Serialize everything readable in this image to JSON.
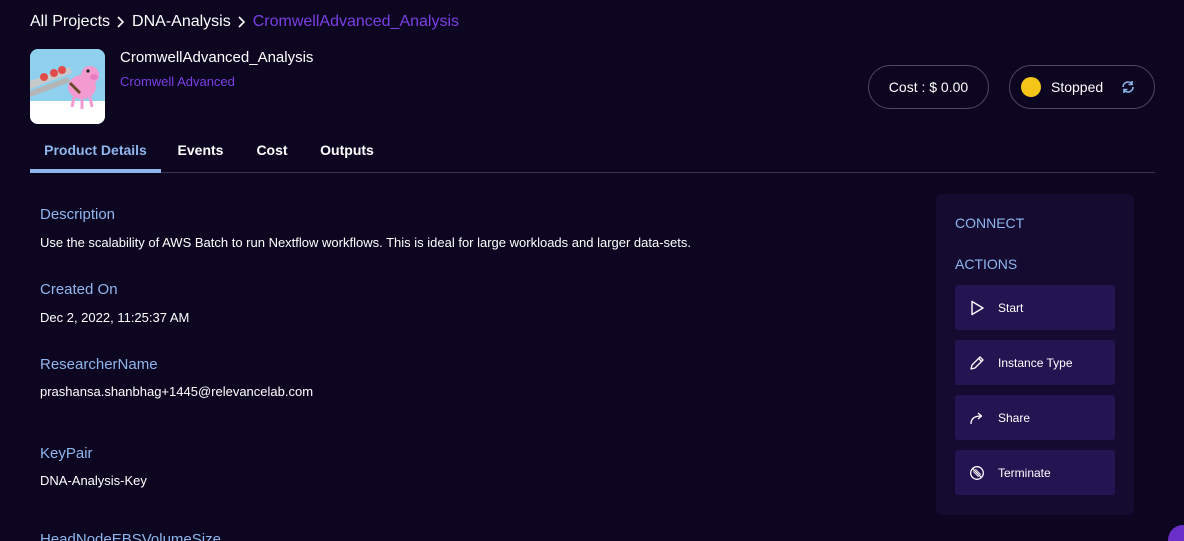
{
  "breadcrumb": {
    "items": [
      "All Projects",
      "DNA-Analysis",
      "CromwellAdvanced_Analysis"
    ]
  },
  "product": {
    "title": "CromwellAdvanced_Analysis",
    "subtitle": "Cromwell Advanced",
    "logo_icon": "flying-pig-logo"
  },
  "cost": {
    "label": "Cost : $ 0.00"
  },
  "status": {
    "label": "Stopped",
    "color": "#f5c518"
  },
  "tabs": [
    {
      "label": "Product Details",
      "active": true
    },
    {
      "label": "Events",
      "active": false
    },
    {
      "label": "Cost",
      "active": false
    },
    {
      "label": "Outputs",
      "active": false
    }
  ],
  "details": [
    {
      "label": "Description",
      "value": "Use the scalability of AWS Batch to run Nextflow workflows. This is ideal for large workloads and larger data-sets."
    },
    {
      "label": "Created On",
      "value": "Dec 2, 2022, 11:25:37 AM"
    },
    {
      "label": "ResearcherName",
      "value": "prashansa.shanbhag+1445@relevancelab.com"
    },
    {
      "label": "KeyPair",
      "value": "DNA-Analysis-Key"
    },
    {
      "label": "HeadNodeEBSVolumeSize",
      "value": ""
    }
  ],
  "panel": {
    "connect_heading": "CONNECT",
    "actions_heading": "ACTIONS",
    "actions": [
      {
        "label": "Start",
        "icon": "play-icon"
      },
      {
        "label": "Instance Type",
        "icon": "pencil-icon"
      },
      {
        "label": "Share",
        "icon": "share-icon"
      },
      {
        "label": "Terminate",
        "icon": "terminate-icon"
      }
    ]
  },
  "colors": {
    "background": "#0c0620",
    "accent_purple": "#7b3fe4",
    "label_blue": "#8fb7ee",
    "panel": "#150b31",
    "button": "#241451"
  }
}
